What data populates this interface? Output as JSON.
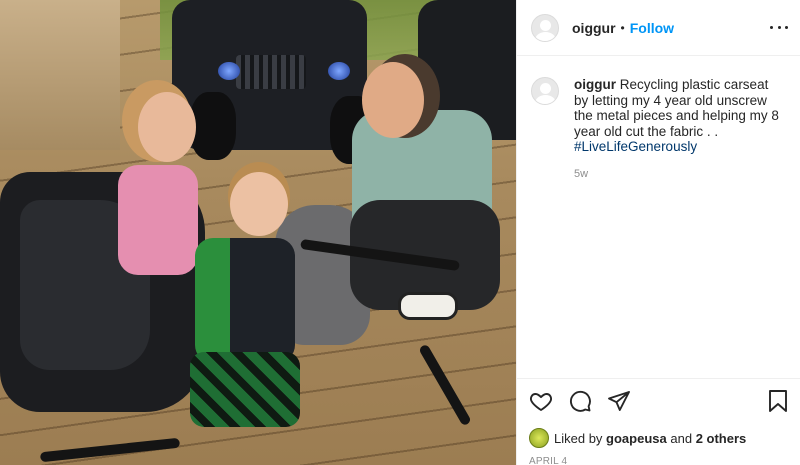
{
  "header": {
    "username": "oiggur",
    "separator": "•",
    "follow_label": "Follow"
  },
  "caption": {
    "username": "oiggur",
    "text": "Recycling plastic carseat by letting my 4 year old unscrew the metal pieces and helping my 8 year old cut the fabric . .",
    "hashtag": "#LiveLifeGenerously",
    "time": "5w"
  },
  "likes": {
    "prefix": "Liked by",
    "user": "goapeusa",
    "middle": "and",
    "others": "2 others"
  },
  "date": "APRIL 4",
  "icons": {
    "like": "heart-icon",
    "comment": "comment-icon",
    "share": "share-icon",
    "save": "bookmark-icon",
    "more": "more-options-icon"
  },
  "colors": {
    "follow": "#0095f6",
    "hashtag": "#00376b",
    "muted": "#8e8e8e",
    "text": "#262626"
  }
}
